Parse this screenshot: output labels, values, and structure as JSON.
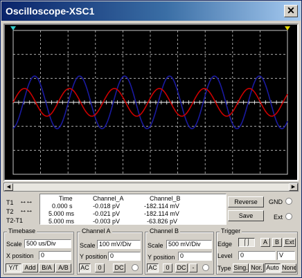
{
  "window": {
    "title": "Oscilloscope-XSC1",
    "close_glyph": "✕"
  },
  "scroll": {
    "left_glyph": "◀",
    "right_glyph": "▶"
  },
  "readout": {
    "rows": [
      {
        "label": "T1",
        "arrows": "↔↔"
      },
      {
        "label": "T2",
        "arrows": "↔↔"
      },
      {
        "label": "T2-T1",
        "arrows": ""
      }
    ],
    "headers": {
      "time": "Time",
      "channel_a": "Channel_A",
      "channel_b": "Channel_B"
    },
    "values": [
      {
        "time": "0.000 s",
        "a": "-0.018 pV",
        "b": "-182.114 mV"
      },
      {
        "time": "5.000 ms",
        "a": "-0.021 pV",
        "b": "-182.114 mV"
      },
      {
        "time": "5.000 ms",
        "a": "-0.003 pV",
        "b": "-63.826 pV"
      }
    ]
  },
  "controls": {
    "reverse": "Reverse",
    "save": "Save",
    "gnd": "GND",
    "ext": "Ext"
  },
  "timebase": {
    "title": "Timebase",
    "scale_label": "Scale",
    "scale_value": "500 us/Div",
    "xpos_label": "X position",
    "xpos_value": "0",
    "buttons": [
      "Y/T",
      "Add",
      "B/A",
      "A/B"
    ]
  },
  "channel_a": {
    "title": "Channel A",
    "scale_label": "Scale",
    "scale_value": "100 mV/Div",
    "ypos_label": "Y position",
    "ypos_value": "0",
    "buttons": [
      "AC",
      "0",
      "DC"
    ]
  },
  "channel_b": {
    "title": "Channel B",
    "scale_label": "Scale",
    "scale_value": "500 mV/Div",
    "ypos_label": "Y position",
    "ypos_value": "0",
    "buttons": [
      "AC",
      "0",
      "DC",
      "-"
    ]
  },
  "trigger": {
    "title": "Trigger",
    "edge_label": "Edge",
    "edge_buttons": [
      "A",
      "B",
      "Ext"
    ],
    "level_label": "Level",
    "level_value": "0",
    "level_unit": "V",
    "type_label": "Type",
    "type_buttons": [
      "Sing.",
      "Nor.",
      "Auto",
      "None"
    ]
  },
  "colors": {
    "channel_a": "#cc0000",
    "channel_b": "#1a1aa0",
    "grid": "#c8c8c8",
    "screen_bg": "#000000"
  }
}
